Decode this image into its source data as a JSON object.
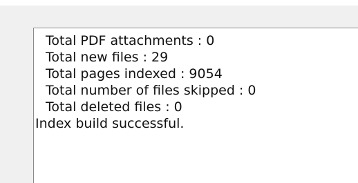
{
  "log": {
    "lines": [
      {
        "text": "Total PDF attachments : 0",
        "indent": true
      },
      {
        "text": "Total new files : 29",
        "indent": true
      },
      {
        "text": "Total pages indexed : 9054",
        "indent": true
      },
      {
        "text": "Total number of files skipped : 0",
        "indent": true
      },
      {
        "text": "Total deleted files : 0",
        "indent": true
      },
      {
        "text": "Index build successful.",
        "indent": false
      }
    ]
  }
}
